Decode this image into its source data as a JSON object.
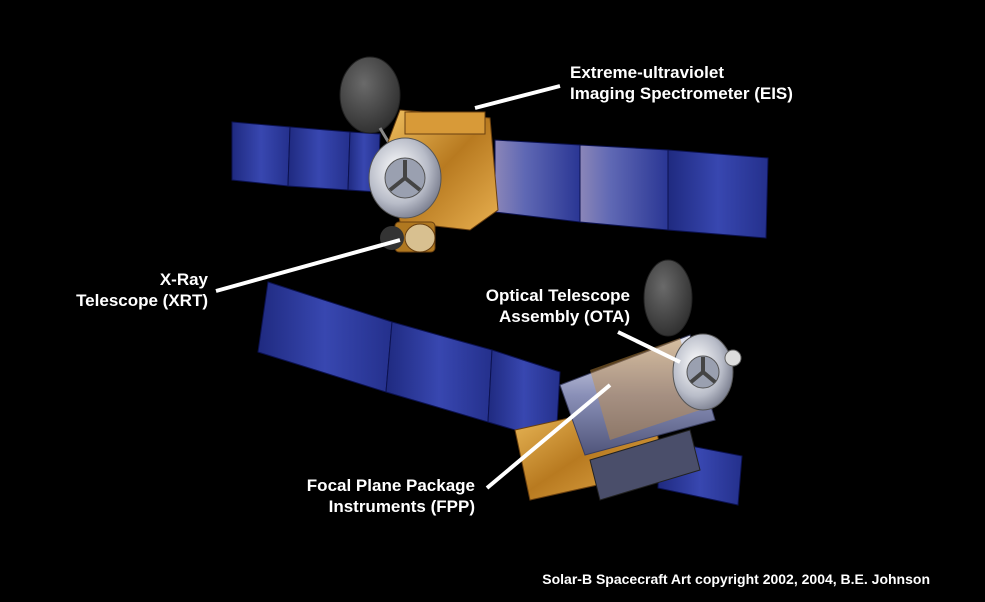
{
  "labels": {
    "eis": {
      "line1": "Extreme-ultraviolet",
      "line2": "Imaging Spectrometer (EIS)"
    },
    "xrt": {
      "line1": "X-Ray",
      "line2": "Telescope (XRT)"
    },
    "ota": {
      "line1": "Optical Telescope",
      "line2": "Assembly (OTA)"
    },
    "fpp": {
      "line1": "Focal Plane Package",
      "line2": "Instruments (FPP)"
    }
  },
  "credit": "Solar-B Spacecraft Art copyright 2002, 2004, B.E. Johnson",
  "colors": {
    "background": "#000000",
    "solar_panel": "#2a3a9a",
    "gold_foil": "#c8922a",
    "text": "#ffffff"
  }
}
